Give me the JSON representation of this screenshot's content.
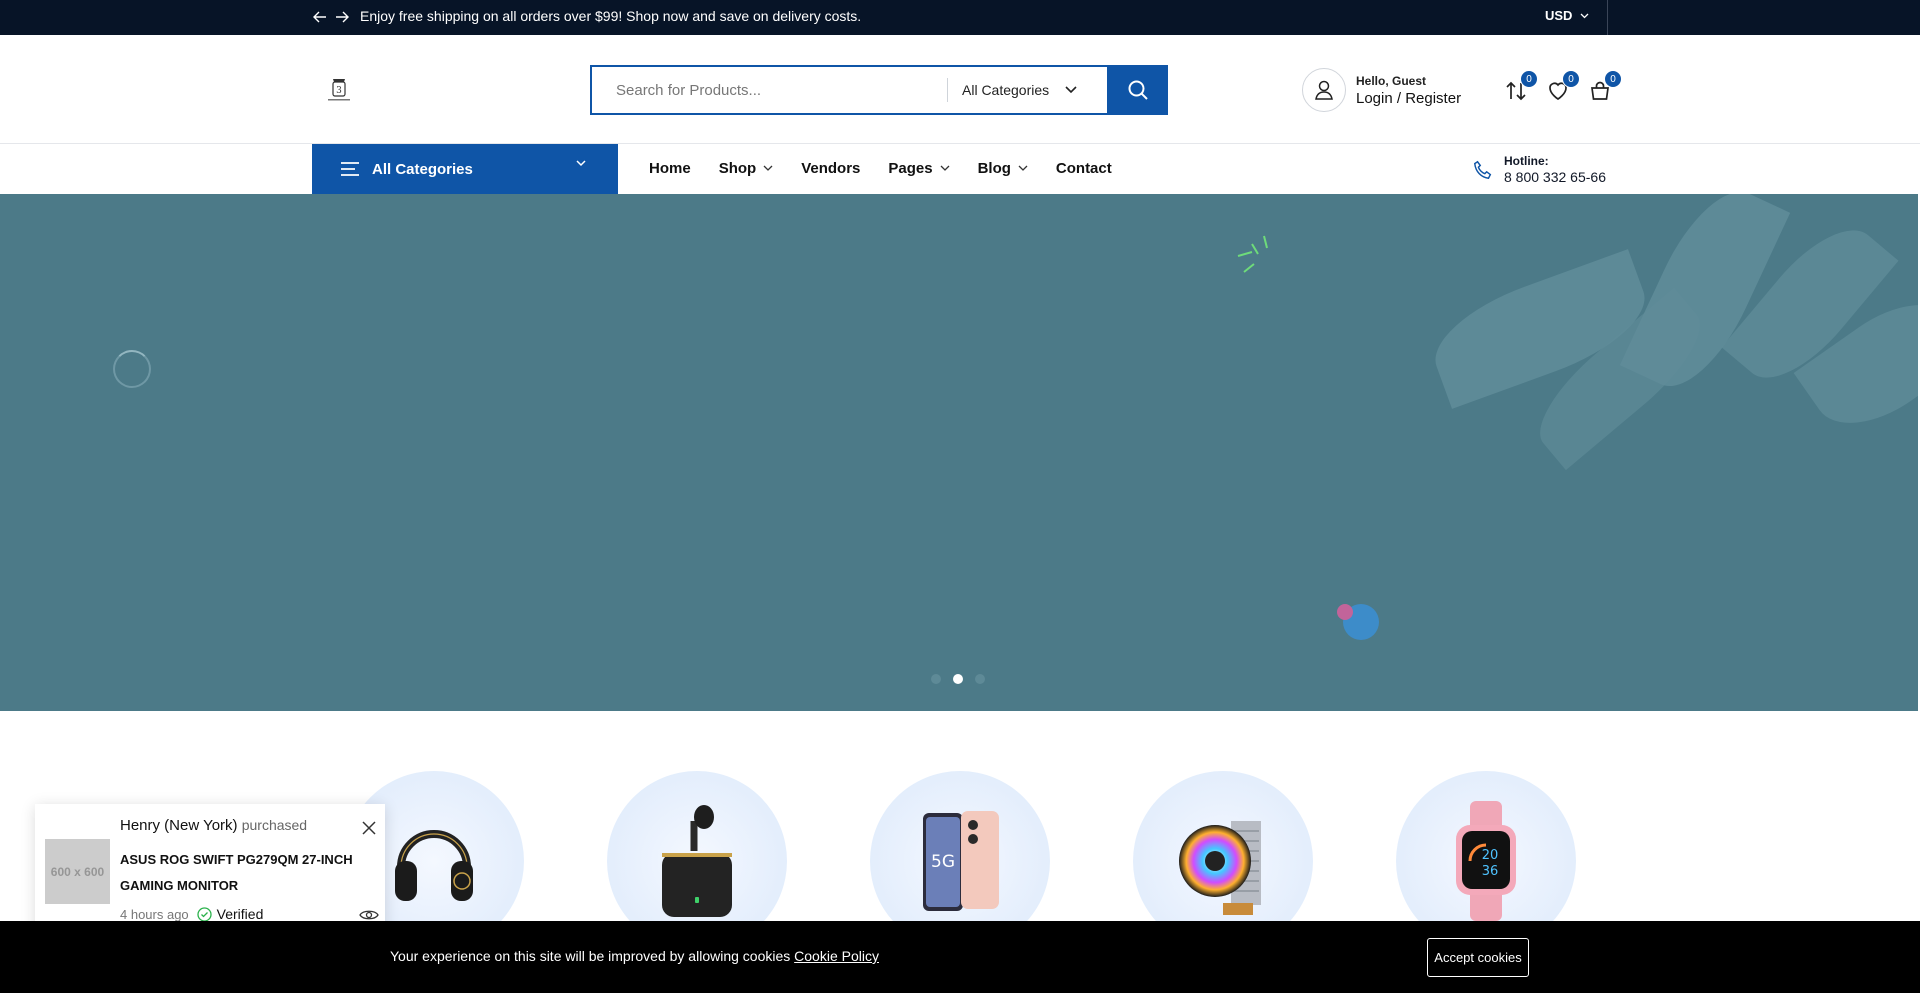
{
  "topbar": {
    "message": "Enjoy free shipping on all orders over $99! Shop now and save on delivery costs.",
    "currency": "USD"
  },
  "header": {
    "search_placeholder": "Search for Products...",
    "category_select": "All Categories",
    "account_greeting": "Hello, Guest",
    "account_link": "Login / Register",
    "compare_count": "0",
    "wishlist_count": "0",
    "cart_count": "0"
  },
  "nav": {
    "all_categories": "All Categories",
    "items": [
      "Home",
      "Shop",
      "Vendors",
      "Pages",
      "Blog",
      "Contact"
    ],
    "hotline_label": "Hotline:",
    "hotline_number": "8 800 332 65-66"
  },
  "hero": {
    "slides": 3,
    "active_slide": 2
  },
  "categories": [
    {
      "icon": "headphones-icon"
    },
    {
      "icon": "earbuds-icon"
    },
    {
      "icon": "smartphone-icon"
    },
    {
      "icon": "cpu-cooler-icon"
    },
    {
      "icon": "smartwatch-icon"
    }
  ],
  "popup": {
    "buyer": "Henry (New York)",
    "action": "purchased",
    "product": "ASUS ROG SWIFT PG279QM 27-INCH GAMING MONITOR",
    "thumb_text": "600 x 600",
    "time": "4 hours ago",
    "verified": "Verified"
  },
  "cookie": {
    "text": "Your experience on this site will be improved by allowing cookies",
    "link": "Cookie Policy",
    "button": "Accept cookies"
  },
  "colors": {
    "brand": "#0f55a7",
    "topbar": "#071427",
    "hero_bg": "#4c7a88",
    "cookie_bg": "#000000"
  }
}
